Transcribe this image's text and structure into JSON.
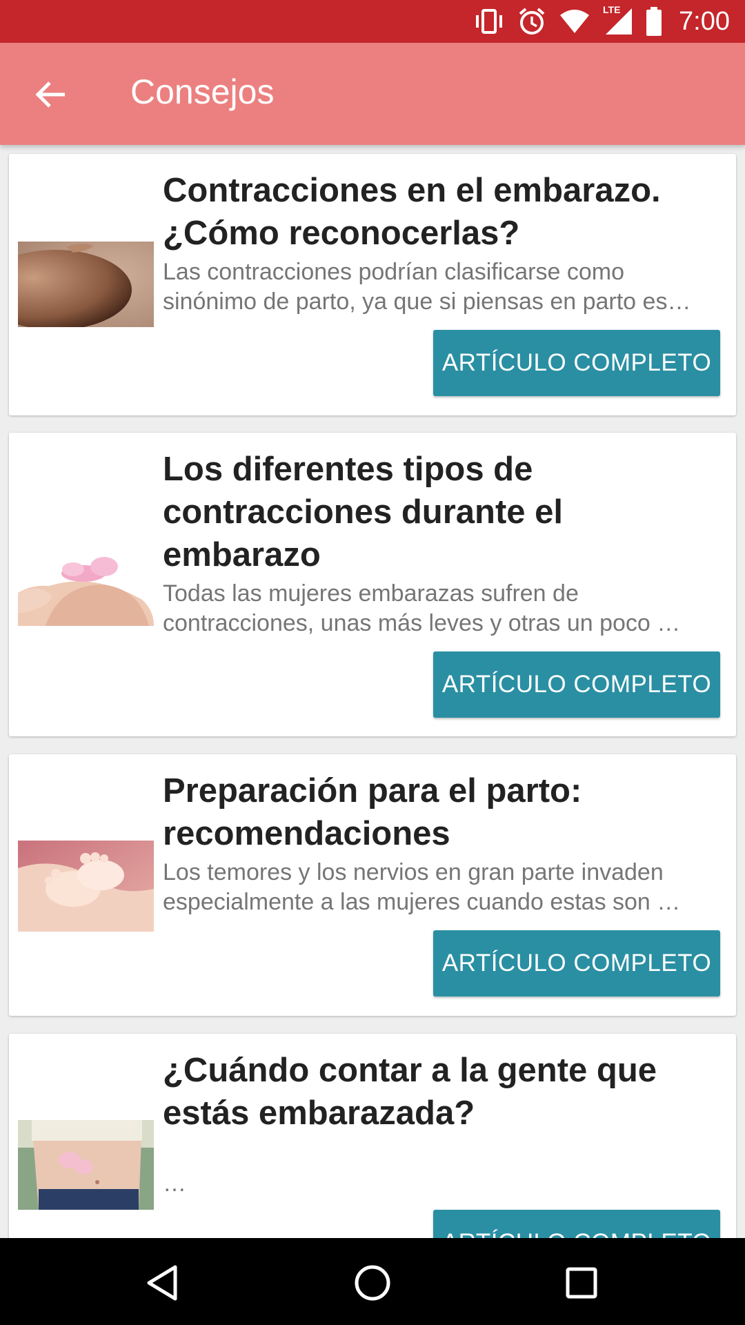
{
  "status_bar": {
    "time": "7:00",
    "background": "#c4262b",
    "icons": [
      "vibrate-icon",
      "alarm-icon",
      "wifi-icon",
      "lte-signal-icon",
      "battery-icon"
    ],
    "network_label": "LTE"
  },
  "app_bar": {
    "title": "Consejos",
    "background": "#ec8080",
    "back_icon": "arrow-back-icon"
  },
  "articles": [
    {
      "title_lines": [
        "Contracciones en el embarazo.",
        "¿Cómo reconocerlas?"
      ],
      "excerpt_lines": [
        "Las contracciones podrían clasificarse como",
        "sinónimo de parto, ya que si piensas en parto es…"
      ],
      "button_label": "ARTÍCULO COMPLETO",
      "thumbnail": "pregnant-belly-photo"
    },
    {
      "title_lines": [
        "Los diferentes tipos de",
        "contracciones durante el",
        "embarazo"
      ],
      "excerpt_lines": [
        "Todas las mujeres embarazas sufren de",
        "contracciones, unas más leves y otras un poco …"
      ],
      "button_label": "ARTÍCULO COMPLETO",
      "thumbnail": "belly-with-baby-shoes-photo"
    },
    {
      "title_lines": [
        "Preparación para el parto:",
        "recomendaciones"
      ],
      "excerpt_lines": [
        "Los temores y los nervios en gran parte invaden",
        "especialmente a las mujeres cuando estas son …"
      ],
      "button_label": "ARTÍCULO COMPLETO",
      "thumbnail": "baby-feet-in-hands-photo"
    },
    {
      "title_lines": [
        "¿Cuándo contar a la gente que",
        "estás embarazada?"
      ],
      "excerpt_lines": [
        "…"
      ],
      "button_label": "ARTÍCULO COMPLETO",
      "thumbnail": "belly-with-pink-shoes-photo"
    }
  ],
  "colors": {
    "button": "#2a8fa3",
    "nav_bar": "#000000"
  },
  "nav_bar": {
    "buttons": [
      "back-triangle-icon",
      "home-circle-icon",
      "recents-square-icon"
    ]
  }
}
